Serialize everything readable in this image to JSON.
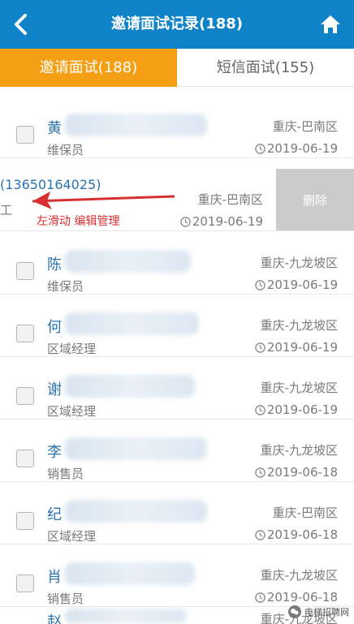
{
  "header": {
    "title": "邀请面试记录(188)"
  },
  "tabs": [
    {
      "label": "邀请面试(188)",
      "active": true
    },
    {
      "label": "短信面试(155)",
      "active": false
    }
  ],
  "rows": [
    {
      "surname": "黄",
      "role": "维保员",
      "location": "重庆-巴南区",
      "date": "2019-06-19"
    },
    {
      "phone": "(13650164025)",
      "role": "工",
      "location": "重庆-巴南区",
      "date": "2019-06-19",
      "swiped": true,
      "delete_label": "删除",
      "annotation": "左滑动  编辑管理"
    },
    {
      "surname": "陈",
      "role": "维保员",
      "location": "重庆-九龙坡区",
      "date": "2019-06-19"
    },
    {
      "surname": "何",
      "role": "区域经理",
      "location": "重庆-九龙坡区",
      "date": "2019-06-19"
    },
    {
      "surname": "谢",
      "role": "区域经理",
      "location": "重庆-九龙坡区",
      "date": "2019-06-19"
    },
    {
      "surname": "李",
      "role": "销售员",
      "location": "重庆-九龙坡区",
      "date": "2019-06-18"
    },
    {
      "surname": "纪",
      "role": "区域经理",
      "location": "重庆-巴南区",
      "date": "2019-06-18"
    },
    {
      "surname": "肖",
      "role": "销售员",
      "location": "重庆-九龙坡区",
      "date": "2019-06-18"
    },
    {
      "surname": "赵",
      "role": "",
      "location": "重庆-九龙坡区",
      "date": ""
    }
  ],
  "watermark": "电梯招聘网",
  "colors": {
    "header": "#0f83c8",
    "active_tab": "#f59f14",
    "name": "#2a72b0",
    "annotation": "#d83030"
  }
}
